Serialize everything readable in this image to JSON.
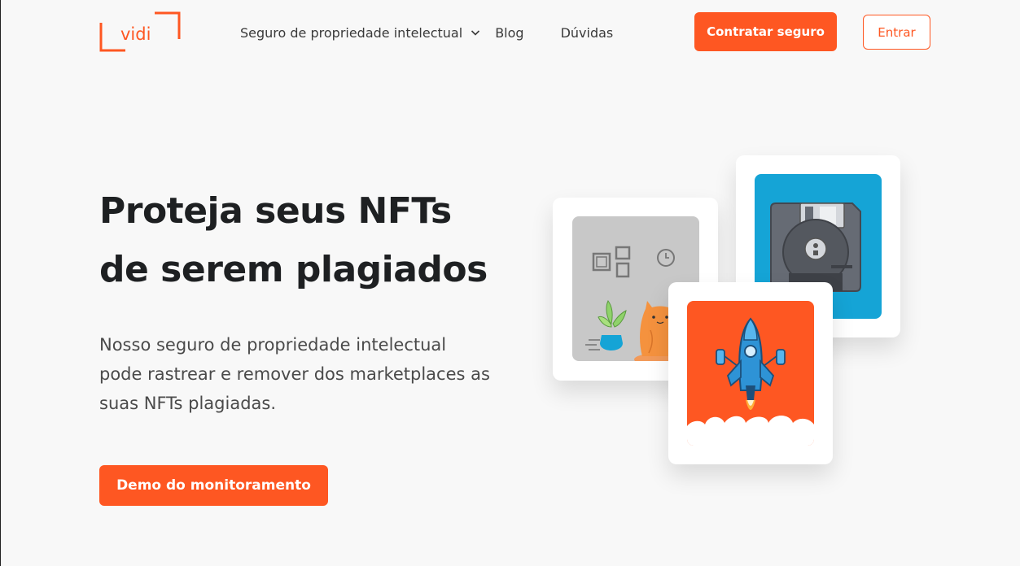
{
  "brand": {
    "logo_text": "vidi",
    "accent": "#fe5722"
  },
  "nav": {
    "items": [
      {
        "label": "Seguro de propriedade intelectual",
        "has_dropdown": true
      },
      {
        "label": "Blog"
      },
      {
        "label": "Dúvidas"
      }
    ],
    "cta_label": "Contratar seguro",
    "login_label": "Entrar"
  },
  "hero": {
    "title_line1": "Proteja seus NFTs",
    "title_line2": "de serem plagiados",
    "subtitle_line1": "Nosso seguro de propriedade intelectual",
    "subtitle_line2": "pode rastrear e remover dos marketplaces as",
    "subtitle_line3": "suas NFTs plagiadas.",
    "cta_label": "Demo do monitoramento"
  },
  "cards": [
    {
      "icon": "cat-room-illustration",
      "bg": "#c8c8c8"
    },
    {
      "icon": "floppy-disk-illustration",
      "bg": "#15a4d6"
    },
    {
      "icon": "rocket-illustration",
      "bg": "#fe5722"
    }
  ]
}
